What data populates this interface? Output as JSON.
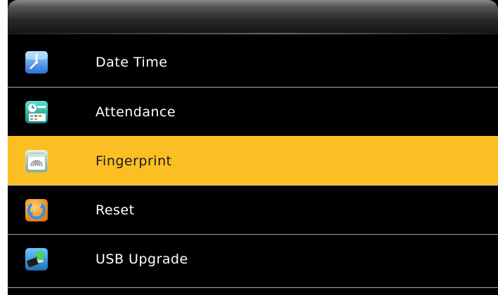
{
  "menu": {
    "items": [
      {
        "label": "Date Time",
        "icon": "date-time-icon",
        "selected": false
      },
      {
        "label": "Attendance",
        "icon": "attendance-icon",
        "selected": false
      },
      {
        "label": "Fingerprint",
        "icon": "fingerprint-icon",
        "selected": true
      },
      {
        "label": "Reset",
        "icon": "reset-icon",
        "selected": false
      },
      {
        "label": "USB Upgrade",
        "icon": "usb-upgrade-icon",
        "selected": false
      }
    ]
  },
  "colors": {
    "background": "#000000",
    "highlight": "#fbbf24",
    "text": "#ffffff",
    "selected_text": "#1a1a1a",
    "divider": "#a8a8a8"
  }
}
